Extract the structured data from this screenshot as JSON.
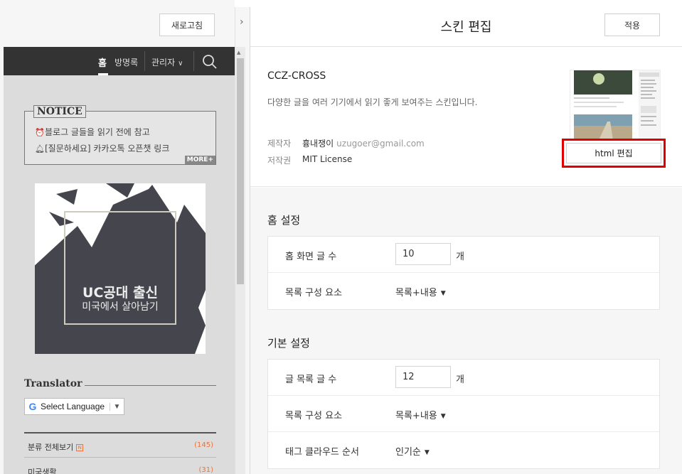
{
  "left": {
    "refresh_label": "새로고침",
    "blog_nav": {
      "home": "홈",
      "guestbook": "방명록",
      "admin": "관리자"
    },
    "notice": {
      "title": "NOTICE",
      "items": [
        "블로그 글들을 읽기 전에 참고",
        "[질문하세요] 카카오톡 오픈챗 링크"
      ],
      "more": "MORE+"
    },
    "banner": {
      "title": "UC공대 출신",
      "subtitle": "미국에서 살아남기"
    },
    "translator": {
      "title": "Translator",
      "select_label": "Select Language",
      "g_letter": "G"
    },
    "categories": [
      {
        "name": "분류 전체보기",
        "badge": "N",
        "count": "(145)"
      },
      {
        "name": "미국생활",
        "count": "(31)"
      }
    ]
  },
  "right": {
    "title": "스킨 편집",
    "apply_label": "적용",
    "skin": {
      "name": "CCZ-CROSS",
      "description": "다양한 글을 여러 기기에서 읽기 좋게 보여주는 스킨입니다.",
      "author_label": "제작자",
      "author_name": "흉내쟁이",
      "author_email": "uzugoer@gmail.com",
      "license_label": "저작권",
      "license_value": "MIT License",
      "html_edit_label": "html 편집"
    },
    "home_settings": {
      "title": "홈 설정",
      "rows": [
        {
          "label": "홈 화면 글 수",
          "value": "10",
          "unit": "개"
        },
        {
          "label": "목록 구성 요소",
          "value": "목록+내용"
        }
      ]
    },
    "basic_settings": {
      "title": "기본 설정",
      "rows": [
        {
          "label": "글 목록 글 수",
          "value": "12",
          "unit": "개"
        },
        {
          "label": "목록 구성 요소",
          "value": "목록+내용"
        },
        {
          "label": "태그 클라우드 순서",
          "value": "인기순"
        }
      ]
    }
  },
  "colors": {
    "highlight_border": "#e00000",
    "accent_orange": "#e8743b",
    "nav_bg": "#333333"
  }
}
